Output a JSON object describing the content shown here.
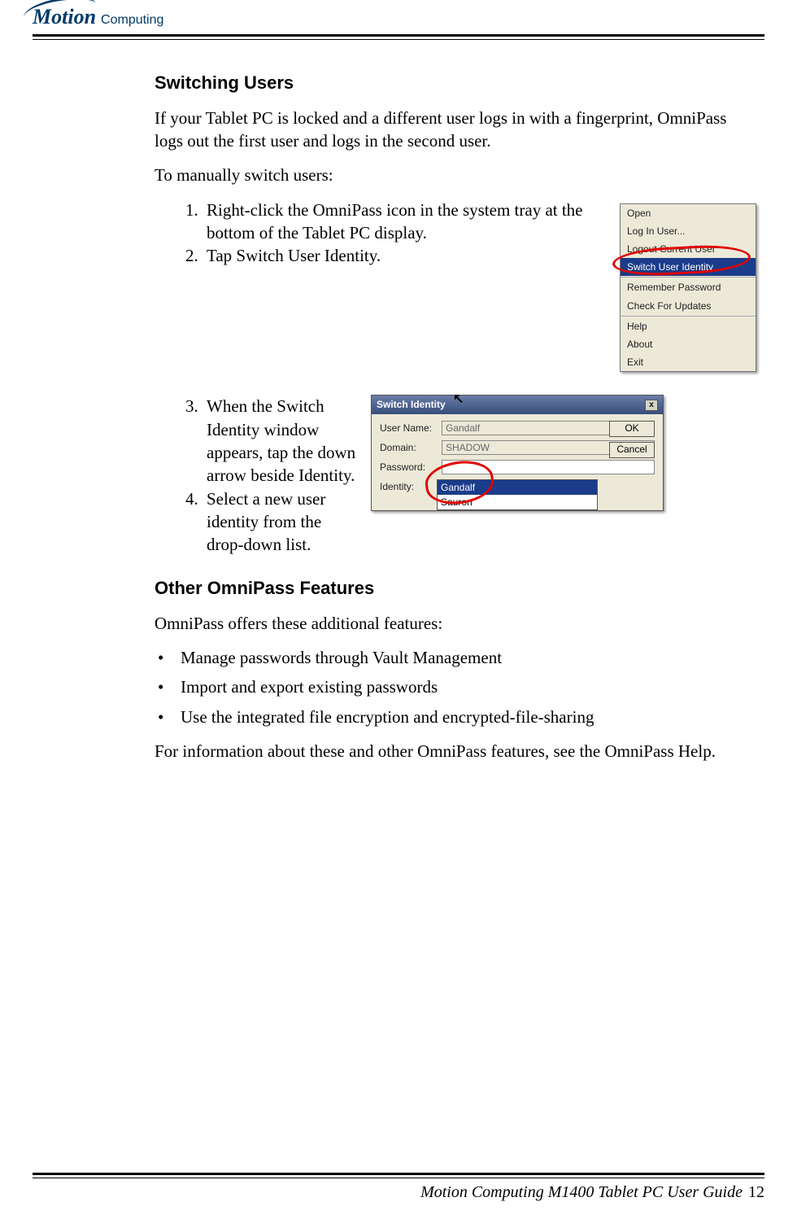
{
  "logo": {
    "brand": "Motion",
    "sub": "Computing"
  },
  "section": {
    "h1": "Switching Users",
    "p1": "If your Tablet PC is locked and a different user logs in with a fingerprint, OmniPass logs out the first user and logs in the second user.",
    "p2": "To manually switch users:",
    "steps1": [
      "Right-click the OmniPass icon in the sys­tem tray at the bottom of the Tablet PC dis­play.",
      "Tap Switch User Identity."
    ],
    "steps2": [
      "When the Switch Iden­tity window appears, tap the down arrow beside Identity.",
      "Select a new user iden­tity from the drop-down list."
    ],
    "h2": "Other OmniPass Features",
    "p3": "OmniPass offers these additional features:",
    "bullets": [
      "Manage passwords through Vault Management",
      "Import and export existing passwords",
      "Use the integrated file encryption and encrypted-file-sharing"
    ],
    "p4": "For information about these and other OmniPass features, see the OmniPass Help."
  },
  "context_menu": {
    "items_top": [
      "Open",
      "Log In User...",
      "Logout Current User"
    ],
    "highlight": "Switch User Identity",
    "items_mid": [
      "Remember Password",
      "Check For Updates"
    ],
    "items_bot": [
      "Help",
      "About",
      "Exit"
    ]
  },
  "dialog": {
    "title": "Switch Identity",
    "labels": {
      "user": "User Name:",
      "domain": "Domain:",
      "password": "Password:",
      "identity": "Identity:"
    },
    "values": {
      "user": "Gandalf",
      "domain": "SHADOW",
      "identity": "Gandalf"
    },
    "dropdown": [
      "Gandalf",
      "Sauron"
    ],
    "buttons": {
      "ok": "OK",
      "cancel": "Cancel"
    },
    "close": "x"
  },
  "footer": {
    "title": "Motion Computing M1400 Tablet PC User Guide",
    "page": "12"
  }
}
